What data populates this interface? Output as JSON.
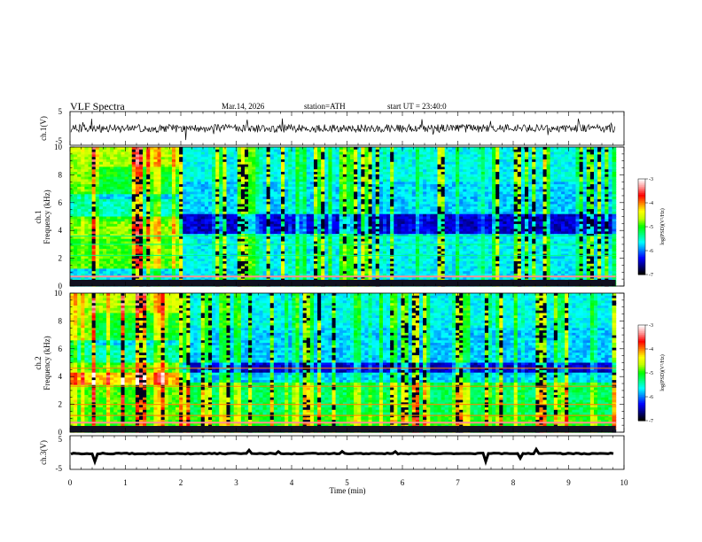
{
  "header": {
    "title": "VLF Spectra",
    "date": "Mar.14, 2026",
    "station": "station=ATH",
    "start_ut": "start UT =  23:40:0"
  },
  "colors": {
    "colormap": [
      "#000000",
      "#000080",
      "#0000ff",
      "#0080ff",
      "#00ffff",
      "#00ff80",
      "#00ff00",
      "#c0ff00",
      "#ffff00",
      "#ff8000",
      "#ff0000",
      "#ff9090",
      "#ffffff"
    ],
    "trace": "#000000"
  },
  "chart_data": [
    {
      "type": "line",
      "panel": "ch1-waveform",
      "ylabel": "ch.1(V)",
      "yticks": [
        "5",
        "-5"
      ],
      "ylim": [
        -5,
        5
      ],
      "x_range_min": [
        0,
        9.85
      ],
      "baseline_v": 0,
      "noise_amplitude_v": 1.2
    },
    {
      "type": "heatmap",
      "panel": "ch1-spectrogram",
      "ylabel_top": "ch.1",
      "ylabel": "Frequency (kHz)",
      "yticks": [
        "0",
        "2",
        "4",
        "6",
        "8",
        "10"
      ],
      "ylim": [
        0,
        10
      ],
      "x_range_min": [
        0,
        9.85
      ],
      "colorbar": {
        "label": "log(PSD)(V²/Hz)",
        "ticks": [
          "-3",
          "-4",
          "-5",
          "-6",
          "-7"
        ],
        "range": [
          -7,
          -3
        ]
      },
      "features": {
        "band_change_min": 1.95,
        "early_band_khz": [
          3.4,
          4.6
        ],
        "dark_band_khz": [
          3.8,
          5.2
        ],
        "persistent_lines_khz": [
          2.2,
          3.0,
          3.6
        ]
      }
    },
    {
      "type": "heatmap",
      "panel": "ch2-spectrogram",
      "ylabel_top": "ch.2",
      "ylabel": "Frequency (kHz)",
      "yticks": [
        "0",
        "2",
        "4",
        "6",
        "8",
        "10"
      ],
      "ylim": [
        0,
        10
      ],
      "x_range_min": [
        0,
        9.85
      ],
      "colorbar": {
        "label": "log(PSD)(V²/Hz)",
        "ticks": [
          "-3",
          "-4",
          "-5",
          "-6",
          "-7"
        ],
        "range": [
          -7,
          -3
        ]
      },
      "features": {
        "band_change_min": 1.95,
        "early_band_khz": [
          3.4,
          4.3
        ],
        "dark_band_khz": [
          4.3,
          5.0
        ],
        "persistent_lines_khz": [
          1.2,
          2.0,
          3.3,
          4.6
        ]
      }
    },
    {
      "type": "line",
      "panel": "ch3-waveform",
      "ylabel": "ch.3(V)",
      "yticks": [
        "5",
        "-5"
      ],
      "ylim": [
        -5,
        5
      ],
      "x_range_min": [
        0,
        9.85
      ],
      "baseline_v": -0.3,
      "noise_amplitude_v": 0.15
    }
  ],
  "xaxis": {
    "label": "Time (min)",
    "ticks": [
      "0",
      "1",
      "2",
      "3",
      "4",
      "5",
      "6",
      "7",
      "8",
      "9",
      "10"
    ],
    "range": [
      0,
      10
    ]
  }
}
